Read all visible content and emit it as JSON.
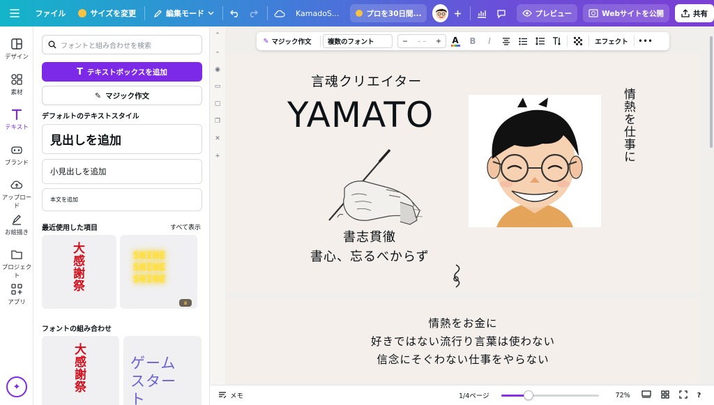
{
  "topbar": {
    "file_label": "ファイル",
    "resize_label": "サイズを変更",
    "edit_mode_label": "編集モード",
    "doc_title": "KamadoS...",
    "pro_trial_label": "プロを30日間...",
    "preview_label": "プレビュー",
    "publish_label": "Webサイトを公開",
    "share_label": "共有"
  },
  "rail": {
    "items": [
      {
        "label": "デザイン",
        "icon": "layout-icon"
      },
      {
        "label": "素材",
        "icon": "shapes-icon"
      },
      {
        "label": "テキスト",
        "icon": "text-T-icon"
      },
      {
        "label": "ブランド",
        "icon": "brand-icon"
      },
      {
        "label": "アップロード",
        "icon": "upload-cloud-icon"
      },
      {
        "label": "お絵描き",
        "icon": "pen-icon"
      },
      {
        "label": "プロジェクト",
        "icon": "folder-icon"
      },
      {
        "label": "アプリ",
        "icon": "apps-icon"
      }
    ],
    "active_color": "#7d2ae8"
  },
  "panel": {
    "search_placeholder": "フォントと組み合わせを検索",
    "add_textbox_label": "テキストボックスを追加",
    "magic_write_label": "マジック作文",
    "default_styles_title": "デフォルトのテキストスタイル",
    "heading_label": "見出しを追加",
    "subheading_label": "小見出しを追加",
    "body_label": "本文を追加",
    "recent_title": "最近使用した項目",
    "show_all_label": "すべて表示",
    "recent_thumb1_text": "大感謝祭",
    "recent_thumb2_text": "SHINE SHINE SHINE",
    "font_combos_title": "フォントの組み合わせ",
    "combo1_text": "大感謝祭",
    "combo2_text": "ゲームスタート"
  },
  "format_bar": {
    "magic_write_label": "マジック作文",
    "font_name": "複数のフォント",
    "font_size_minus": "−",
    "font_size_value": "– –",
    "font_size_plus": "+",
    "effects_label": "エフェクト"
  },
  "canvas": {
    "page1": {
      "subtitle": "言魂クリエイター",
      "name": "YAMATO",
      "motto_1": "書志貫徹",
      "motto_2": "書心、忘るべからず",
      "vertical_text": "情熱を仕事に"
    },
    "page2": {
      "line_1": "情熱をお金に",
      "line_2": "好きではない流行り言葉は使わない",
      "line_3": "信念にそぐわない仕事をやらない"
    }
  },
  "bottombar": {
    "notes_label": "メモ",
    "page_indicator": "1/4ページ",
    "zoom_label": "72%",
    "zoom_fraction": 0.25
  }
}
